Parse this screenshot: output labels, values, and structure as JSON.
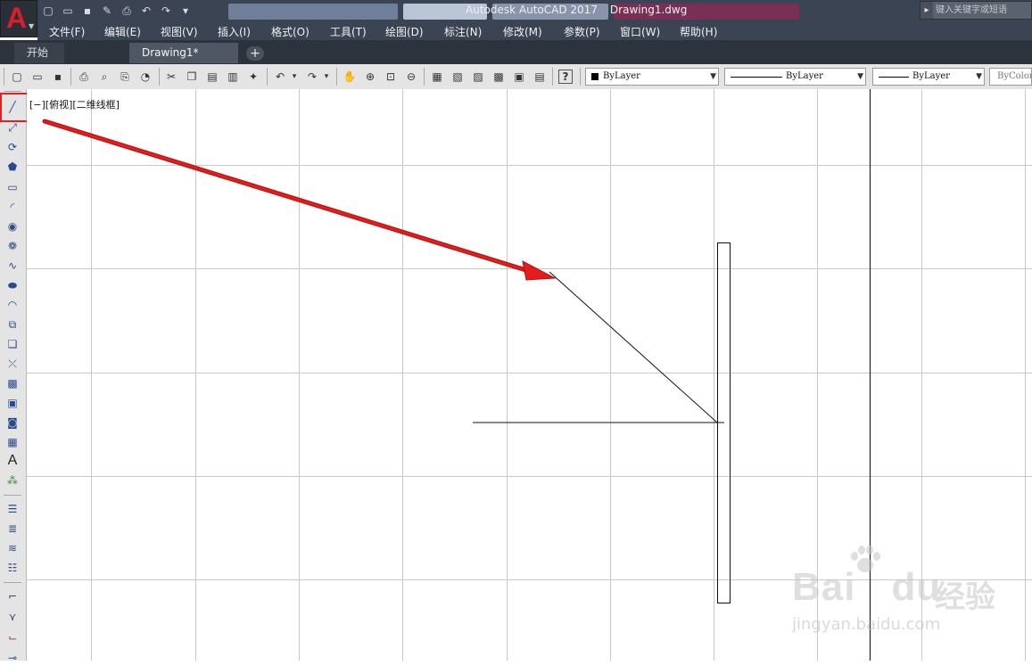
{
  "app": {
    "logo_letter": "A",
    "title": "Autodesk AutoCAD 2017",
    "file_name": "Drawing1.dwg",
    "search_placeholder": "键入关键字或短语"
  },
  "quick_access": [
    "new-icon",
    "open-icon",
    "save-icon",
    "saveas-icon",
    "plot-icon",
    "undo-icon",
    "redo-icon",
    "dropdown-icon"
  ],
  "menu": [
    "文件(F)",
    "编辑(E)",
    "视图(V)",
    "插入(I)",
    "格式(O)",
    "工具(T)",
    "绘图(D)",
    "标注(N)",
    "修改(M)",
    "参数(P)",
    "窗口(W)",
    "帮助(H)"
  ],
  "tabs": {
    "start": "开始",
    "active": "Drawing1*",
    "add": "+"
  },
  "properties": {
    "color": "ByLayer",
    "linetype": "ByLayer",
    "lineweight": "ByLayer",
    "plotstyle": "ByColor"
  },
  "viewport": {
    "label": "[−][俯视][二维线框]"
  },
  "watermark": {
    "brand": "Bai",
    "brand_tail": "du",
    "cn": "经验",
    "url": "jingyan.baidu.com"
  },
  "colors": {
    "titlebar": "#3b4453",
    "highlight": "#e02020",
    "arrow": "#e41c1c",
    "grid": "#c8c8c8"
  }
}
